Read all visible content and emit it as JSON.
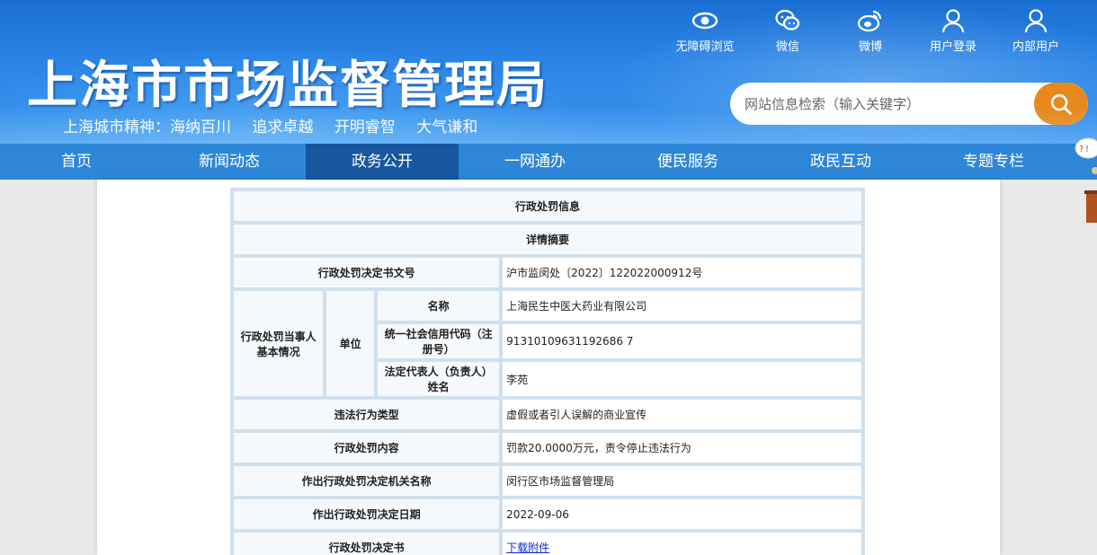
{
  "header": {
    "site_title": "上海市市场监督管理局",
    "slogan": [
      "上海城市精神：海纳百川",
      "追求卓越",
      "开明睿智",
      "大气谦和"
    ],
    "top_links": [
      {
        "label": "无障碍浏览",
        "icon": "eye-icon"
      },
      {
        "label": "微信",
        "icon": "wechat-icon"
      },
      {
        "label": "微博",
        "icon": "weibo-icon"
      },
      {
        "label": "用户登录",
        "icon": "user-icon"
      },
      {
        "label": "内部用户",
        "icon": "user-icon"
      }
    ],
    "search": {
      "placeholder": "网站信息检索（输入关键字）"
    }
  },
  "nav": {
    "items": [
      "首页",
      "新闻动态",
      "政务公开",
      "一网通办",
      "便民服务",
      "政民互动",
      "专题专栏"
    ],
    "active": "政务公开"
  },
  "table": {
    "title": "行政处罚信息",
    "subtitle": "详情摘要",
    "doc_no_label": "行政处罚决定书文号",
    "doc_no_value": "沪市监闵处〔2022〕122022000912号",
    "party_label": "行政处罚当事人基本情况",
    "unit_label": "单位",
    "name_label": "名称",
    "name_value": "上海民生中医大药业有限公司",
    "credit_code_label": "统一社会信用代码（注册号）",
    "credit_code_value": "91310109631192686 7",
    "legal_rep_label": "法定代表人（负责人）姓名",
    "legal_rep_value": "李苑",
    "violation_type_label": "违法行为类型",
    "violation_type_value": "虚假或者引人误解的商业宣传",
    "penalty_content_label": "行政处罚内容",
    "penalty_content_value": "罚款20.0000万元，责令停止违法行为",
    "authority_label": "作出行政处罚决定机关名称",
    "authority_value": "闵行区市场监督管理局",
    "date_label": "作出行政处罚决定日期",
    "date_value": "2022-09-06",
    "decision_doc_label": "行政处罚决定书",
    "decision_doc_link": "下载附件"
  },
  "colors": {
    "header_blue": "#2b86e6",
    "nav_blue": "#2e86d8",
    "nav_active": "#16579f",
    "search_button": "#e8891c",
    "table_border": "#cfe0ee"
  }
}
